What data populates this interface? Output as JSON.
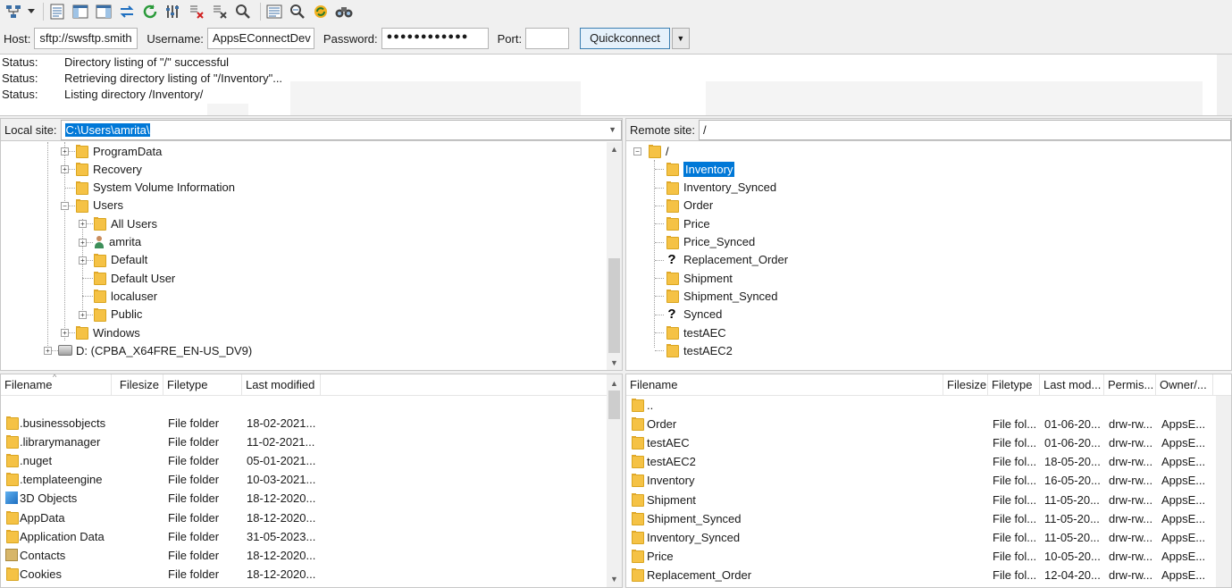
{
  "toolbar": {
    "icons": [
      "site-manager-icon",
      "dropdown-arrow-icon",
      "toggle-message-log-icon",
      "toggle-local-tree-icon",
      "toggle-remote-tree-icon",
      "toggle-transfer-queue-icon",
      "refresh-icon",
      "process-queue-icon",
      "cancel-operation-icon",
      "disconnect-icon",
      "reconnect-icon",
      "directory-filter-icon",
      "compare-directories-icon",
      "sync-browsing-icon",
      "find-files-icon"
    ]
  },
  "quickconnect": {
    "host_label": "Host:",
    "host_value": "sftp://swsftp.smith",
    "username_label": "Username:",
    "username_value": "AppsEConnectDev",
    "password_label": "Password:",
    "password_value": "●●●●●●●●●●●●",
    "port_label": "Port:",
    "port_value": "",
    "button_label": "Quickconnect"
  },
  "log": [
    {
      "key": "Status:",
      "msg": "Directory listing of \"/\" successful"
    },
    {
      "key": "Status:",
      "msg": "Retrieving directory listing of \"/Inventory\"..."
    },
    {
      "key": "Status:",
      "msg": "Listing directory /Inventory/"
    }
  ],
  "local": {
    "site_label": "Local site:",
    "path": "C:\\Users\\amrita\\",
    "tree": [
      {
        "name": "ProgramData",
        "indent": 0,
        "expander": "+"
      },
      {
        "name": "Recovery",
        "indent": 0,
        "expander": "+"
      },
      {
        "name": "System Volume Information",
        "indent": 0,
        "expander": ""
      },
      {
        "name": "Users",
        "indent": 0,
        "expander": "-"
      },
      {
        "name": "All Users",
        "indent": 1,
        "expander": "+"
      },
      {
        "name": "amrita",
        "indent": 1,
        "expander": "+",
        "icon": "user"
      },
      {
        "name": "Default",
        "indent": 1,
        "expander": "+"
      },
      {
        "name": "Default User",
        "indent": 1,
        "expander": ""
      },
      {
        "name": "localuser",
        "indent": 1,
        "expander": ""
      },
      {
        "name": "Public",
        "indent": 1,
        "expander": "+"
      },
      {
        "name": "Windows",
        "indent": 0,
        "expander": "+"
      },
      {
        "name": "D: (CPBA_X64FRE_EN-US_DV9)",
        "indent": -1,
        "expander": "+",
        "icon": "drive"
      }
    ],
    "columns": [
      "Filename",
      "Filesize",
      "Filetype",
      "Last modified"
    ],
    "files": [
      {
        "name": ".businessobjects",
        "size": "",
        "type": "File folder",
        "modified": "18-02-2021...",
        "icon": "folder"
      },
      {
        "name": ".librarymanager",
        "size": "",
        "type": "File folder",
        "modified": "11-02-2021...",
        "icon": "folder"
      },
      {
        "name": ".nuget",
        "size": "",
        "type": "File folder",
        "modified": "05-01-2021...",
        "icon": "folder"
      },
      {
        "name": ".templateengine",
        "size": "",
        "type": "File folder",
        "modified": "10-03-2021...",
        "icon": "folder"
      },
      {
        "name": "3D Objects",
        "size": "",
        "type": "File folder",
        "modified": "18-12-2020...",
        "icon": "3d"
      },
      {
        "name": "AppData",
        "size": "",
        "type": "File folder",
        "modified": "18-12-2020...",
        "icon": "folder"
      },
      {
        "name": "Application Data",
        "size": "",
        "type": "File folder",
        "modified": "31-05-2023...",
        "icon": "folder"
      },
      {
        "name": "Contacts",
        "size": "",
        "type": "File folder",
        "modified": "18-12-2020...",
        "icon": "contacts"
      },
      {
        "name": "Cookies",
        "size": "",
        "type": "File folder",
        "modified": "18-12-2020...",
        "icon": "folder"
      }
    ]
  },
  "remote": {
    "site_label": "Remote site:",
    "path": "/",
    "root": "/",
    "tree": [
      {
        "name": "Inventory",
        "icon": "folder",
        "selected": true
      },
      {
        "name": "Inventory_Synced",
        "icon": "folder"
      },
      {
        "name": "Order",
        "icon": "folder"
      },
      {
        "name": "Price",
        "icon": "folder"
      },
      {
        "name": "Price_Synced",
        "icon": "folder"
      },
      {
        "name": "Replacement_Order",
        "icon": "question"
      },
      {
        "name": "Shipment",
        "icon": "folder"
      },
      {
        "name": "Shipment_Synced",
        "icon": "folder"
      },
      {
        "name": "Synced",
        "icon": "question"
      },
      {
        "name": "testAEC",
        "icon": "folder"
      },
      {
        "name": "testAEC2",
        "icon": "folder"
      }
    ],
    "columns": [
      "Filename",
      "Filesize",
      "Filetype",
      "Last mod...",
      "Permis...",
      "Owner/..."
    ],
    "files": [
      {
        "name": "..",
        "type": "",
        "modified": "",
        "perm": "",
        "owner": ""
      },
      {
        "name": "Order",
        "type": "File fol...",
        "modified": "01-06-20...",
        "perm": "drw-rw...",
        "owner": "AppsE..."
      },
      {
        "name": "testAEC",
        "type": "File fol...",
        "modified": "01-06-20...",
        "perm": "drw-rw...",
        "owner": "AppsE..."
      },
      {
        "name": "testAEC2",
        "type": "File fol...",
        "modified": "18-05-20...",
        "perm": "drw-rw...",
        "owner": "AppsE..."
      },
      {
        "name": "Inventory",
        "type": "File fol...",
        "modified": "16-05-20...",
        "perm": "drw-rw...",
        "owner": "AppsE..."
      },
      {
        "name": "Shipment",
        "type": "File fol...",
        "modified": "11-05-20...",
        "perm": "drw-rw...",
        "owner": "AppsE..."
      },
      {
        "name": "Shipment_Synced",
        "type": "File fol...",
        "modified": "11-05-20...",
        "perm": "drw-rw...",
        "owner": "AppsE..."
      },
      {
        "name": "Inventory_Synced",
        "type": "File fol...",
        "modified": "11-05-20...",
        "perm": "drw-rw...",
        "owner": "AppsE..."
      },
      {
        "name": "Price",
        "type": "File fol...",
        "modified": "10-05-20...",
        "perm": "drw-rw...",
        "owner": "AppsE..."
      },
      {
        "name": "Replacement_Order",
        "type": "File fol...",
        "modified": "12-04-20...",
        "perm": "drw-rw...",
        "owner": "AppsE..."
      }
    ]
  },
  "colors": {
    "selection": "#0078d7",
    "folder": "#f5c245",
    "quickconnect_border": "#3c7fb1"
  }
}
